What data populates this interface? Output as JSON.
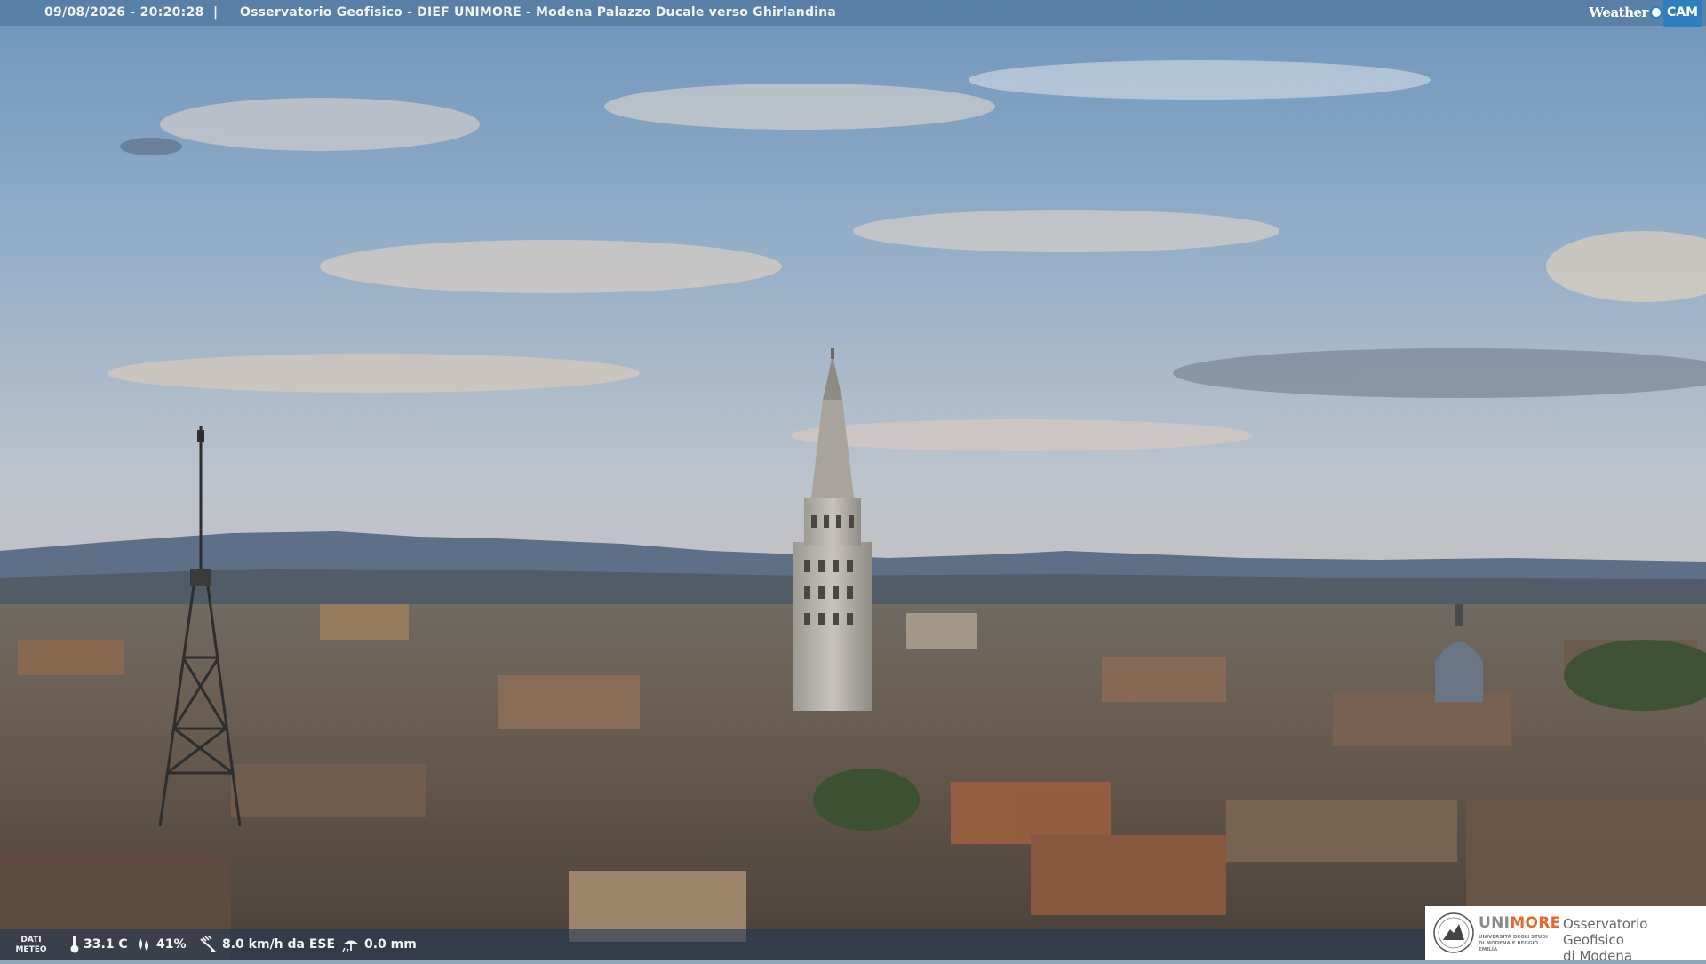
{
  "header": {
    "timestamp": "09/08/2026 - 20:20:28",
    "separator": "|",
    "title": "Osservatorio Geofisico - DIEF UNIMORE - Modena Palazzo Ducale verso Ghirlandina"
  },
  "watermark": {
    "word": "Weather",
    "cam": "CAM"
  },
  "weather": {
    "label_line1": "DATI",
    "label_line2": "METEO",
    "temperature": "33.1 C",
    "humidity": "41%",
    "wind": "8.0 km/h da ESE",
    "rain": "0.0 mm",
    "icons": {
      "temperature": "thermometer-icon",
      "humidity": "droplet-icon",
      "wind": "wind-icon",
      "rain": "rain-icon"
    }
  },
  "logo": {
    "uni": "UNI",
    "more": "MORE",
    "subtitle": "UNIVERSITÀ DEGLI STUDI DI MODENA E REGGIO EMILIA",
    "observatory_line1": "Osservatorio Geofisico",
    "observatory_line2": "di Modena"
  },
  "colors": {
    "accent": "#2e7fc0",
    "unimore_orange": "#e2692f"
  }
}
